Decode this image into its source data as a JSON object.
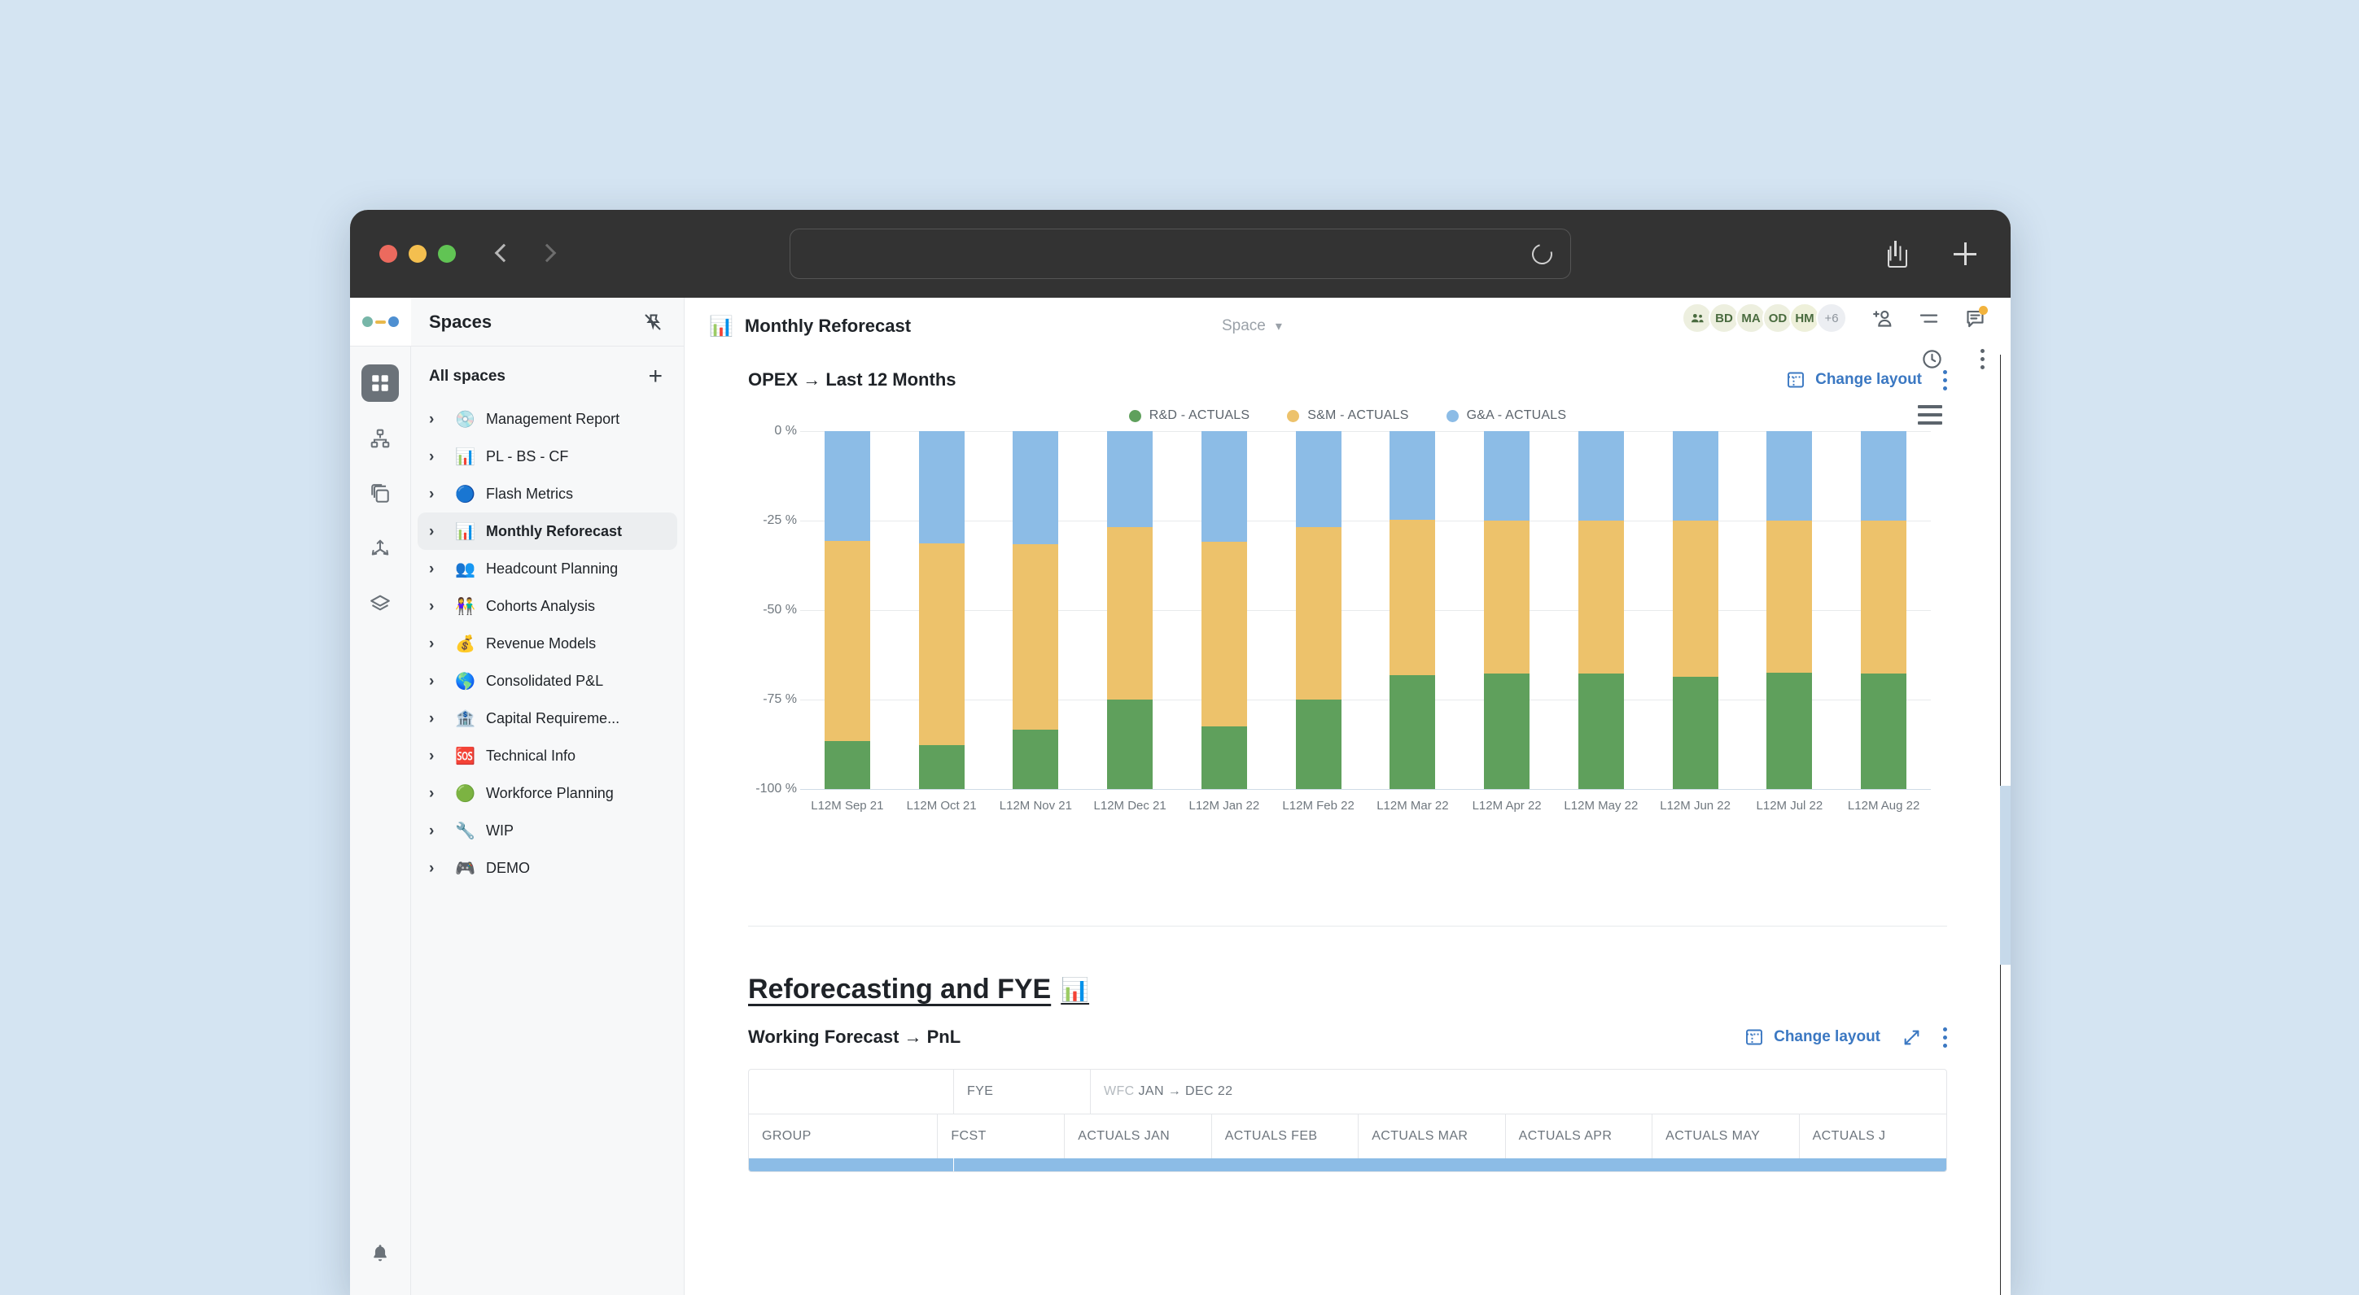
{
  "browser": {
    "url_value": "",
    "url_placeholder": "",
    "reload_icon": "reload-icon",
    "share_icon": "share-icon",
    "new_tab_icon": "plus-icon",
    "back_icon": "back-arrow-icon",
    "forward_icon": "forward-arrow-icon"
  },
  "rail": {
    "items": [
      {
        "name": "grid-icon",
        "active": true
      },
      {
        "name": "org-chart-icon",
        "active": false
      },
      {
        "name": "copies-icon",
        "active": false
      },
      {
        "name": "share-nodes-icon",
        "active": false
      },
      {
        "name": "layers-icon",
        "active": false
      }
    ],
    "bell_icon": "bell-icon"
  },
  "sidebar": {
    "title": "Spaces",
    "pin_icon": "unpin-icon",
    "all_spaces_label": "All spaces",
    "add_icon": "plus-icon",
    "items": [
      {
        "emoji": "💿",
        "label": "Management Report",
        "selected": false
      },
      {
        "emoji": "📊",
        "label": "PL - BS - CF",
        "selected": false
      },
      {
        "emoji": "🔵",
        "label": "Flash Metrics",
        "selected": false
      },
      {
        "emoji": "📊",
        "label": "Monthly Reforecast",
        "selected": true
      },
      {
        "emoji": "👥",
        "label": "Headcount Planning",
        "selected": false
      },
      {
        "emoji": "👫",
        "label": "Cohorts Analysis",
        "selected": false
      },
      {
        "emoji": "💰",
        "label": "Revenue Models",
        "selected": false
      },
      {
        "emoji": "🌎",
        "label": "Consolidated P&L",
        "selected": false
      },
      {
        "emoji": "🏦",
        "label": "Capital Requireme...",
        "selected": false
      },
      {
        "emoji": "🆘",
        "label": "Technical Info",
        "selected": false
      },
      {
        "emoji": "🟢",
        "label": "Workforce Planning",
        "selected": false
      },
      {
        "emoji": "🔧",
        "label": "WIP",
        "selected": false
      },
      {
        "emoji": "🎮",
        "label": "DEMO",
        "selected": false
      }
    ]
  },
  "topbar": {
    "doc_emoji": "📊",
    "doc_title": "Monthly Reforecast",
    "scope_label": "Space",
    "scope_caret": "chevron-down-icon",
    "avatars": [
      {
        "label": "",
        "kind": "group"
      },
      {
        "label": "BD",
        "kind": "initials"
      },
      {
        "label": "MA",
        "kind": "initials"
      },
      {
        "label": "OD",
        "kind": "initials"
      },
      {
        "label": "HM",
        "kind": "initials"
      },
      {
        "label": "+6",
        "kind": "more"
      }
    ],
    "add_user_icon": "add-user-icon",
    "filter_icon": "filter-lines-icon",
    "comments_icon": "comment-icon",
    "comments_has_badge": true,
    "history_icon": "clock-history-icon",
    "more_icon": "kebab-menu-icon"
  },
  "section_opex": {
    "title": "OPEX → Last 12 Months",
    "change_layout_label": "Change layout",
    "change_layout_icon": "layout-icon",
    "more_icon": "kebab-menu-icon",
    "chart_menu_icon": "hamburger-icon"
  },
  "chart_data": {
    "type": "bar",
    "stacked": true,
    "title": "OPEX → Last 12 Months",
    "xlabel": "",
    "ylabel": "",
    "ylim": [
      -100,
      0
    ],
    "yticks": [
      "0 %",
      "-25 %",
      "-50 %",
      "-75 %",
      "-100 %"
    ],
    "ytick_values": [
      0,
      -25,
      -50,
      -75,
      -100
    ],
    "grid": true,
    "legend_position": "top-center",
    "categories": [
      "L12M Sep 21",
      "L12M Oct 21",
      "L12M Nov 21",
      "L12M Dec 21",
      "L12M Jan 22",
      "L12M Feb 22",
      "L12M Mar 22",
      "L12M Apr 22",
      "L12M May 22",
      "L12M Jun 22",
      "L12M Jul 22",
      "L12M Aug 22"
    ],
    "series": [
      {
        "name": "R&D - ACTUALS",
        "color": "#5FA05C",
        "values": [
          -13.5,
          -12.2,
          -16.5,
          -25.0,
          -17.6,
          -25.1,
          -31.9,
          -32.2,
          -32.2,
          -31.4,
          -32.6,
          -32.2
        ]
      },
      {
        "name": "S&M - ACTUALS",
        "color": "#EDC26B",
        "values": [
          -55.9,
          -56.5,
          -51.8,
          -48.1,
          -51.4,
          -48.0,
          -43.4,
          -42.9,
          -42.9,
          -43.6,
          -42.4,
          -42.7
        ]
      },
      {
        "name": "G&A - ACTUALS",
        "color": "#8CBCE6",
        "values": [
          -30.6,
          -31.3,
          -31.7,
          -26.9,
          -31.0,
          -26.9,
          -24.7,
          -24.9,
          -24.9,
          -25.0,
          -25.0,
          -25.1
        ]
      }
    ]
  },
  "section_reforecast": {
    "page_title": "Reforecasting and FYE",
    "page_title_emoji": "📊",
    "widget_title": "Working Forecast → PnL",
    "change_layout_label": "Change layout",
    "change_layout_icon": "layout-icon",
    "expand_icon": "expand-icon",
    "more_icon": "kebab-menu-icon",
    "table": {
      "group_header_row": {
        "blank": "",
        "fye": "FYE",
        "wfc_prefix": "WFC",
        "wfc_range": "JAN → DEC 22"
      },
      "columns": [
        "GROUP",
        "FCST",
        "ACTUALS JAN",
        "ACTUALS FEB",
        "ACTUALS MAR",
        "ACTUALS APR",
        "ACTUALS MAY",
        "ACTUALS J"
      ]
    }
  },
  "colors": {
    "accent_blue": "#3b78c2",
    "series_green": "#5FA05C",
    "series_orange": "#EDC26B",
    "series_blue": "#8CBCE6",
    "page_bg": "#d4e4f2",
    "chrome": "#333333"
  }
}
